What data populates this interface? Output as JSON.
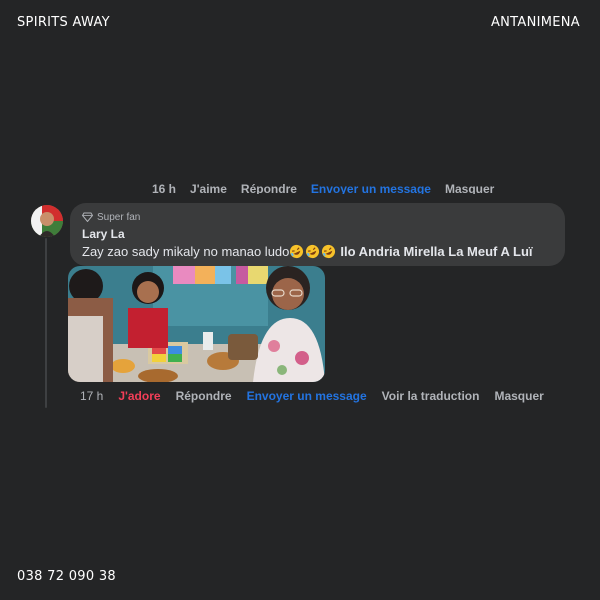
{
  "page": {
    "brand": "SPIRITS AWAY",
    "location": "ANTANIMENA",
    "phone": "038 72 090 38"
  },
  "previous_actions": {
    "time": "16 h",
    "like": "J'aime",
    "reply": "Répondre",
    "message": "Envoyer un message",
    "hide": "Masquer"
  },
  "comment": {
    "badge_icon": "diamond-icon",
    "badge": "Super fan",
    "author": "Lary La",
    "text": "Zay zao sady mikaly no manao ludo",
    "emojis": [
      "rolling-laughing-emoji",
      "rolling-laughing-emoji",
      "rolling-laughing-emoji"
    ],
    "mention": "Ilo Andria Mirella La Meuf A Luï",
    "photo_icon": "group-photo-image"
  },
  "actions": {
    "time": "17 h",
    "reaction": "J'adore",
    "reply": "Répondre",
    "message": "Envoyer un message",
    "translate": "Voir la traduction",
    "hide": "Masquer"
  },
  "colors": {
    "background": "#242526",
    "bubble": "#3a3b3c",
    "text": "#e4e6eb",
    "muted": "#b0b3b8",
    "love": "#f33e58",
    "link": "#2374e1"
  }
}
